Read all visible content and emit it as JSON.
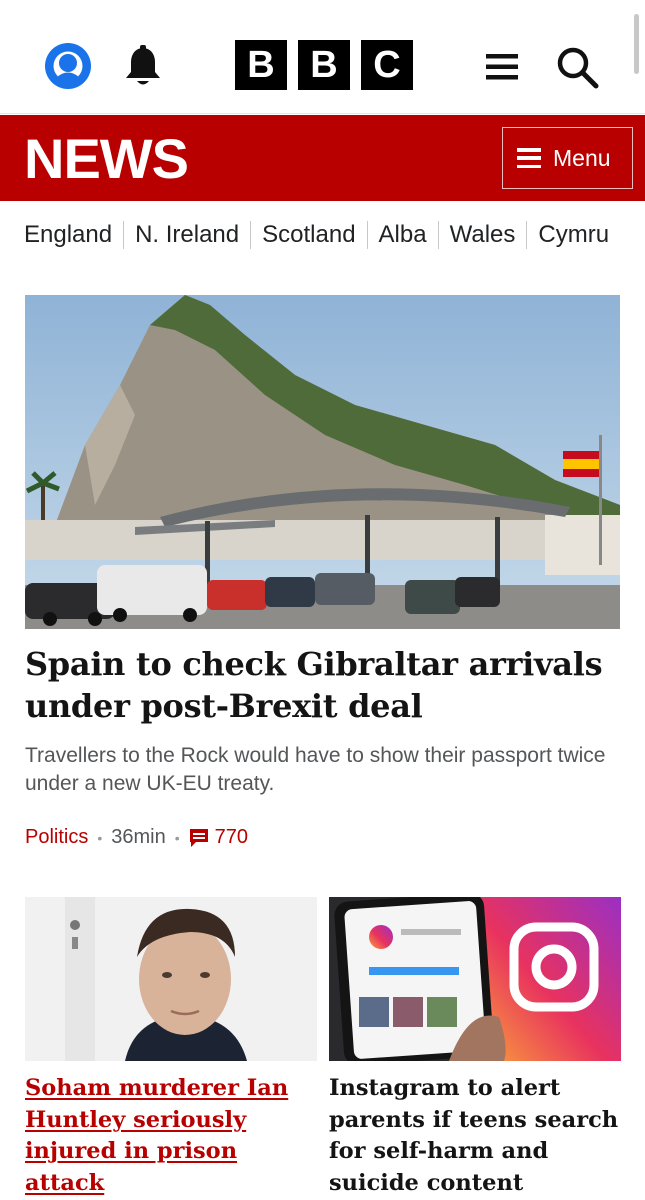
{
  "header": {
    "logo_letters": [
      "B",
      "B",
      "C"
    ],
    "icons": [
      "account-icon",
      "bell-icon",
      "hamburger-icon",
      "search-icon"
    ]
  },
  "news_bar": {
    "title": "NEWS",
    "menu_label": "Menu",
    "background": "#b80000"
  },
  "regions": [
    "England",
    "N. Ireland",
    "Scotland",
    "Alba",
    "Wales",
    "Cymru"
  ],
  "hero": {
    "headline": "Spain to check Gibraltar arrivals under post-Brexit deal",
    "summary": "Travellers to the Rock would have to show their passport twice under a new UK-EU treaty.",
    "topic": "Politics",
    "time": "36min",
    "comments": "770"
  },
  "stories": [
    {
      "headline": "Soham murderer Ian Huntley seriously injured in prison attack"
    },
    {
      "headline": "Instagram to alert parents if teens search for self-harm and suicide content"
    }
  ],
  "colors": {
    "brand_red": "#b80000",
    "account_blue": "#1a73e8"
  }
}
